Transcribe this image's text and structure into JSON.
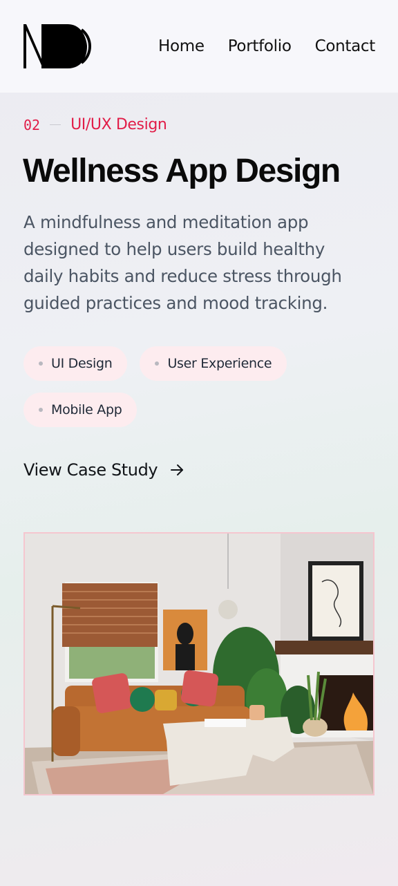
{
  "nav": {
    "home": "Home",
    "portfolio": "Portfolio",
    "contact": "Contact"
  },
  "project": {
    "number": "02",
    "category": "UI/UX Design",
    "title": "Wellness App Design",
    "description": "A mindfulness and meditation app designed to help users build healthy daily habits and reduce stress through guided practices and mood tracking.",
    "tags": [
      "UI Design",
      "User Experience",
      "Mobile App"
    ],
    "cta": "View Case Study"
  },
  "colors": {
    "accent": "#e11d48",
    "tag_bg": "#fdecef",
    "image_border": "#f5c6cf"
  },
  "icons": {
    "cta": "arrow-right-icon"
  }
}
